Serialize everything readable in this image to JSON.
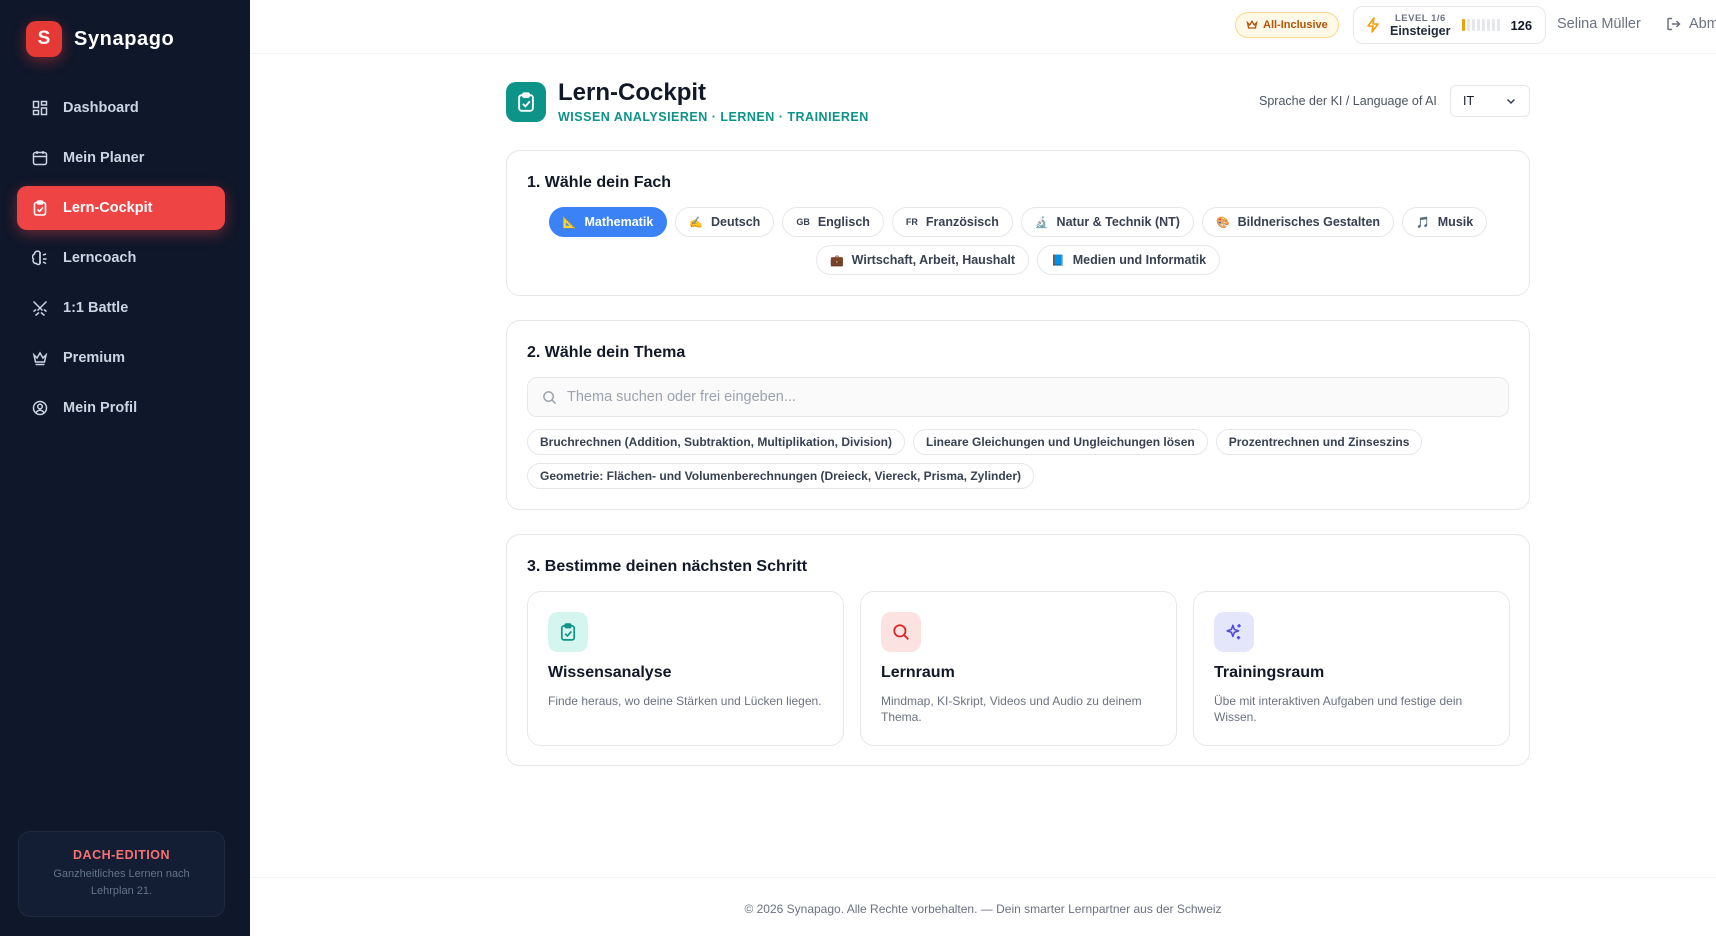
{
  "brand": {
    "logo_letter": "S",
    "name": "Synapago"
  },
  "nav": [
    {
      "label": "Dashboard",
      "icon": "dashboard-icon"
    },
    {
      "label": "Mein Planer",
      "icon": "calendar-icon"
    },
    {
      "label": "Lern-Cockpit",
      "icon": "clipboard-check-icon",
      "active": true
    },
    {
      "label": "Lerncoach",
      "icon": "brain-icon"
    },
    {
      "label": "1:1 Battle",
      "icon": "swords-icon"
    },
    {
      "label": "Premium",
      "icon": "crown-icon"
    },
    {
      "label": "Mein Profil",
      "icon": "user-circle-icon"
    }
  ],
  "edition": {
    "title": "DACH-EDITION",
    "description": "Ganzheitliches Lernen nach Lehrplan 21."
  },
  "topbar": {
    "plan": "All-Inclusive",
    "level_label": "LEVEL 1/6",
    "level_name": "Einsteiger",
    "points": "126",
    "level_progress": 0.1,
    "user": "Selina Müller",
    "logout": "Abmelden"
  },
  "header": {
    "title": "Lern-Cockpit",
    "subtitle": "WISSEN ANALYSIEREN · LERNEN · TRAINIEREN",
    "language_label": "Sprache der KI / Language of AI",
    "language_value": "IT"
  },
  "subjects": {
    "title": "1. Wähle dein Fach",
    "row1": [
      {
        "label": "Mathematik",
        "emoji": "📐",
        "active": true
      },
      {
        "label": "Deutsch",
        "emoji": "✍️"
      },
      {
        "label": "Englisch",
        "emoji": "GB"
      },
      {
        "label": "Französisch",
        "emoji": "FR"
      },
      {
        "label": "Natur & Technik (NT)",
        "emoji": "🔬"
      },
      {
        "label": "Bildnerisches Gestalten",
        "emoji": "🎨"
      },
      {
        "label": "Musik",
        "emoji": "🎵"
      }
    ],
    "row2": [
      {
        "label": "Wirtschaft, Arbeit, Haushalt",
        "emoji": "💼"
      },
      {
        "label": "Medien und Informatik",
        "emoji": "📘"
      }
    ]
  },
  "topics": {
    "title": "2. Wähle dein Thema",
    "search_placeholder": "Thema suchen oder frei eingeben...",
    "row1": [
      "Bruchrechnen (Addition, Subtraktion, Multiplikation, Division)",
      "Lineare Gleichungen und Ungleichungen lösen",
      "Prozentrechnen und Zinseszins"
    ],
    "row2": [
      "Geometrie: Flächen- und Volumenberechnungen (Dreieck, Viereck, Prisma, Zylinder)"
    ]
  },
  "steps": {
    "title": "3. Bestimme deinen nächsten Schritt",
    "items": [
      {
        "title": "Wissensanalyse",
        "description": "Finde heraus, wo deine Stärken und Lücken liegen.",
        "icon": "clipboard-check-icon",
        "color": "#0d9488",
        "bg": "#d5f5ef"
      },
      {
        "title": "Lernraum",
        "description": "Mindmap, KI-Skript, Videos und Audio zu deinem Thema.",
        "icon": "search-icon",
        "color": "#dc2626",
        "bg": "#fde2e2"
      },
      {
        "title": "Trainingsraum",
        "description": "Übe mit interaktiven Aufgaben und festige dein Wissen.",
        "icon": "sparkles-icon",
        "color": "#4f46e5",
        "bg": "#e4e6fb"
      }
    ]
  },
  "footer": "© 2026 Synapago. Alle Rechte vorbehalten. — Dein smarter Lernpartner aus der Schweiz"
}
